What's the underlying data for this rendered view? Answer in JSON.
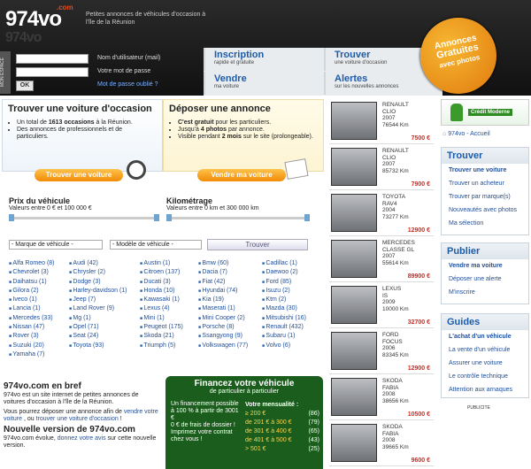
{
  "header": {
    "logo": "974vo",
    "logo_com": ".com",
    "tagline": "Petites annonces de véhicules d'occasion à l'île de la Réunion",
    "login_side": "MON ESPACE",
    "username_label": "Nom d'utilisateur (mail)",
    "password_label": "Votre mot de passe",
    "ok": "OK",
    "forgot": "Mot de passe oublié ?",
    "badge": [
      "Annonces",
      "Gratuites",
      "avec photos"
    ]
  },
  "nav": [
    {
      "title": "Inscription",
      "sub": "rapide et gratuite"
    },
    {
      "title": "Trouver",
      "sub": "une voiture d'occasion"
    },
    {
      "title": "Vendre",
      "sub": "ma voiture"
    },
    {
      "title": "Alertes",
      "sub": "sur les nouvelles annonces"
    }
  ],
  "find": {
    "title": "Trouver une voiture d'occasion",
    "bullet1_pre": "Un total de ",
    "bullet1_bold": "1613 occasions",
    "bullet1_post": " à la Réunion.",
    "bullet2": "Des annonces de professionnels et de particuliers.",
    "button": "Trouver une voiture"
  },
  "sell": {
    "title": "Déposer une annonce",
    "b1_bold": "C'est gratuit",
    "b1_post": " pour les particuliers.",
    "b2_pre": "Jusqu'à ",
    "b2_bold": "4 photos",
    "b2_post": " par annonce.",
    "b3_pre": "Visible pendant ",
    "b3_bold": "2 mois",
    "b3_post": " sur le site (prolongeable).",
    "button": "Vendre ma voiture"
  },
  "price": {
    "title": "Prix du véhicule",
    "range": "Valeurs entre 0 € et 100 000 €"
  },
  "km": {
    "title": "Kilométrage",
    "range": "Valeurs entre 0 km et 300 000 km"
  },
  "search": {
    "brand_select": "- Marque de véhicule -",
    "model_select": "- Modèle de véhicule -",
    "button": "Trouver"
  },
  "brands": [
    [
      "Alfa Romeo (8)",
      "Chevrolet (3)",
      "Daihatsu (1)",
      "Gilora (2)",
      "Iveco (1)",
      "Lancia (1)",
      "Mercedes (33)",
      "Nissan (47)",
      "Rover (3)",
      "Suzuki (20)",
      "Yamaha (7)"
    ],
    [
      "Audi (42)",
      "Chrysler (2)",
      "Dodge (3)",
      "Harley-davidson (1)",
      "Jeep (7)",
      "Land Rover (9)",
      "Mg (1)",
      "Opel (71)",
      "Seat (24)",
      "Toyota (93)"
    ],
    [
      "Austin (1)",
      "Citroen (137)",
      "Ducati (3)",
      "Honda (10)",
      "Kawasaki (1)",
      "Lexus (4)",
      "Mini (1)",
      "Peugeot (175)",
      "Skoda (21)",
      "Triumph (5)"
    ],
    [
      "Bmw (60)",
      "Dacia (7)",
      "Fiat (42)",
      "Hyundai (74)",
      "Kia (19)",
      "Maserati (1)",
      "Mini Cooper (2)",
      "Porsche (8)",
      "Ssangyong (9)",
      "Volkswagen (77)"
    ],
    [
      "Cadillac (1)",
      "Daewoo (2)",
      "Ford (85)",
      "Isuzu (2)",
      "Ktm (2)",
      "Mazda (30)",
      "Mitsubishi (16)",
      "Renault (432)",
      "Subaru (1)",
      "Volvo (6)"
    ]
  ],
  "about": {
    "title": "974vo.com en bref",
    "p1": "974vo est un site internet de petites annonces de voitures d'occasion à l'île de la Réunion.",
    "p2_pre": "Vous pourrez déposer une annonce afin de ",
    "p2_link1": "vendre votre voiture",
    "p2_mid": " , ou ",
    "p2_link2": "trouver une voiture d'occasion",
    "p2_post": " !",
    "new_title": "Nouvelle version de 974vo.com",
    "p3_pre": "974vo.com évolue, ",
    "p3_link": "donnez votre avis",
    "p3_post": " sur cette nouvelle version."
  },
  "finance": {
    "title": "Financez votre véhicule",
    "sub": "de particulier à particulier",
    "left": [
      "Un financement possible à 100 % à partir de 3001 €",
      "0 € de frais de dossier !",
      "Imprimez votre contrat chez vous !"
    ],
    "right_title": "Votre mensualité :",
    "rows": [
      [
        "≥ 200 €",
        "(86)"
      ],
      [
        "de 201 € à 300 €",
        "(79)"
      ],
      [
        "de 301 € à 400 €",
        "(65)"
      ],
      [
        "de 401 € à 500 €",
        "(43)"
      ],
      [
        "> 501 €",
        "(25)"
      ]
    ]
  },
  "cars": [
    {
      "make": "RENAULT",
      "model": "CLIO",
      "year": "2007",
      "km": "76544 Km",
      "price": "7500 €"
    },
    {
      "make": "RENAULT",
      "model": "CLIO",
      "year": "2007",
      "km": "85732 Km",
      "price": "7900 €"
    },
    {
      "make": "TOYOTA",
      "model": "RAV4",
      "year": "2004",
      "km": "73277 Km",
      "price": "12900 €"
    },
    {
      "make": "MERCEDES",
      "model": "CLASSE GL",
      "year": "2007",
      "km": "55614 Km",
      "price": "89900 €"
    },
    {
      "make": "LEXUS",
      "model": "IS",
      "year": "2009",
      "km": "10000 Km",
      "price": "32700 €"
    },
    {
      "make": "FORD",
      "model": "FOCUS",
      "year": "2006",
      "km": "83345 Km",
      "price": "12900 €"
    },
    {
      "make": "SKODA",
      "model": "FABIA",
      "year": "2008",
      "km": "38656 Km",
      "price": "10500 €"
    },
    {
      "make": "SKODA",
      "model": "FABIA",
      "year": "2008",
      "km": "39665 Km",
      "price": "9600 €"
    }
  ],
  "sidebar": {
    "credit": "Crédit Moderne",
    "home": "974vo - Accueil",
    "trouver": {
      "title": "Trouver",
      "items": [
        "Trouver une voiture",
        "Trouver un acheteur",
        "Trouver par marque(s)",
        "Nouveautés avec photos",
        "Ma sélection"
      ]
    },
    "publier": {
      "title": "Publier",
      "items": [
        "Vendre ma voiture",
        "Déposer une alerte",
        "M'inscrire"
      ]
    },
    "guides": {
      "title": "Guides",
      "items": [
        "L'achat d'un véhicule",
        "La vente d'un véhicule",
        "Assurer une voiture",
        "Le contrôle technique",
        "Attention aux arnaques"
      ]
    },
    "publicite": "PUBLICITE"
  }
}
